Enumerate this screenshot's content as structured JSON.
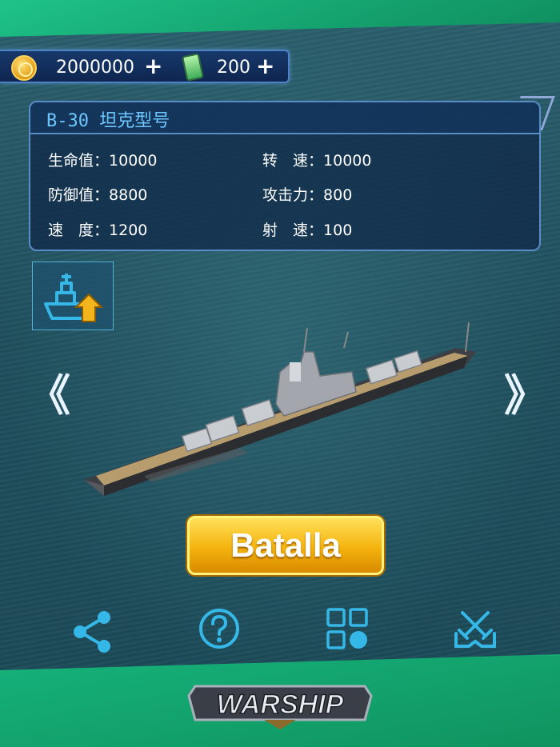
{
  "currency": {
    "gold": "2000000",
    "gems": "200",
    "plus": "+"
  },
  "ship_panel": {
    "title": "B-30 坦克型号",
    "stats": [
      {
        "label": "生命值：",
        "value": "10000"
      },
      {
        "label": "转　速：",
        "value": "10000"
      },
      {
        "label": "防御值：",
        "value": "8800"
      },
      {
        "label": "攻击力：",
        "value": "800"
      },
      {
        "label": "速　度：",
        "value": "1200"
      },
      {
        "label": "射　速：",
        "value": "100"
      }
    ]
  },
  "nav": {
    "prev": "《",
    "next": "》"
  },
  "battle_button": "Batalla",
  "bottom_icons": [
    "share-icon",
    "help-icon",
    "apps-icon",
    "battle-crossed-swords-icon"
  ],
  "upgrade_icon": "ship-upgrade-icon",
  "logo_text": "WARSHIP",
  "colors": {
    "accent_blue": "#6ec6ff",
    "icon_cyan": "#35b8e8",
    "battle_gold": "#f5b30d",
    "frame_green": "#1aa774"
  }
}
